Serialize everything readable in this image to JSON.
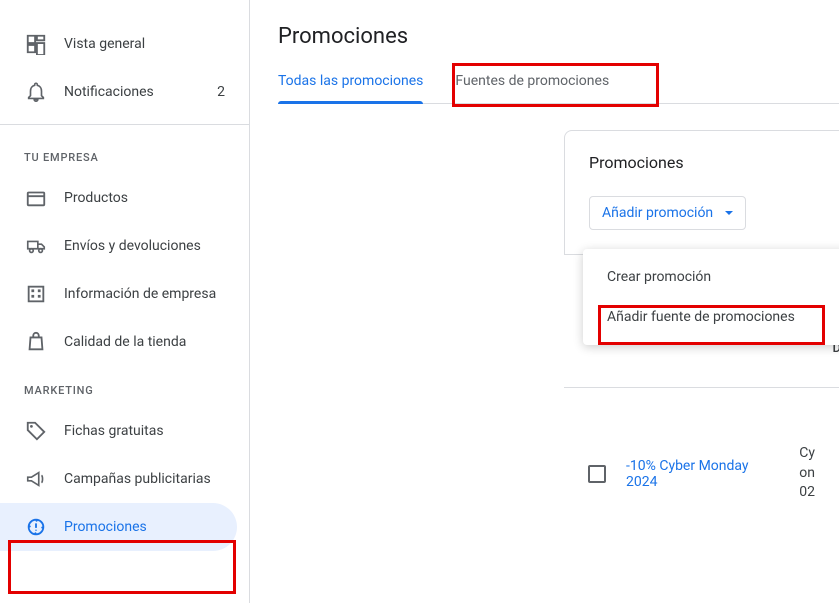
{
  "sidebar": {
    "top_items": [
      {
        "label": "Vista general",
        "icon": "dashboard"
      },
      {
        "label": "Notificaciones",
        "icon": "bell",
        "count": "2"
      }
    ],
    "sections": [
      {
        "header": "TU EMPRESA",
        "items": [
          {
            "label": "Productos",
            "icon": "box"
          },
          {
            "label": "Envíos y devoluciones",
            "icon": "truck"
          },
          {
            "label": "Información de empresa",
            "icon": "building"
          },
          {
            "label": "Calidad de la tienda",
            "icon": "bag"
          }
        ]
      },
      {
        "header": "MARKETING",
        "items": [
          {
            "label": "Fichas gratuitas",
            "icon": "tag"
          },
          {
            "label": "Campañas publicitarias",
            "icon": "megaphone"
          },
          {
            "label": "Promociones",
            "icon": "badge",
            "active": true
          }
        ]
      }
    ]
  },
  "main": {
    "title": "Promociones",
    "tabs": [
      {
        "label": "Todas las promociones",
        "active": true
      },
      {
        "label": "Fuentes de promociones"
      }
    ],
    "panel": {
      "title": "Promociones",
      "add_button": "Añadir promoción",
      "dropdown": [
        "Crear promoción",
        "Añadir fuente de promociones"
      ],
      "column_fragment": "D",
      "row": {
        "name": "-10% Cyber Monday 2024",
        "meta_lines": [
          "Cy",
          "on",
          "02"
        ]
      }
    }
  }
}
